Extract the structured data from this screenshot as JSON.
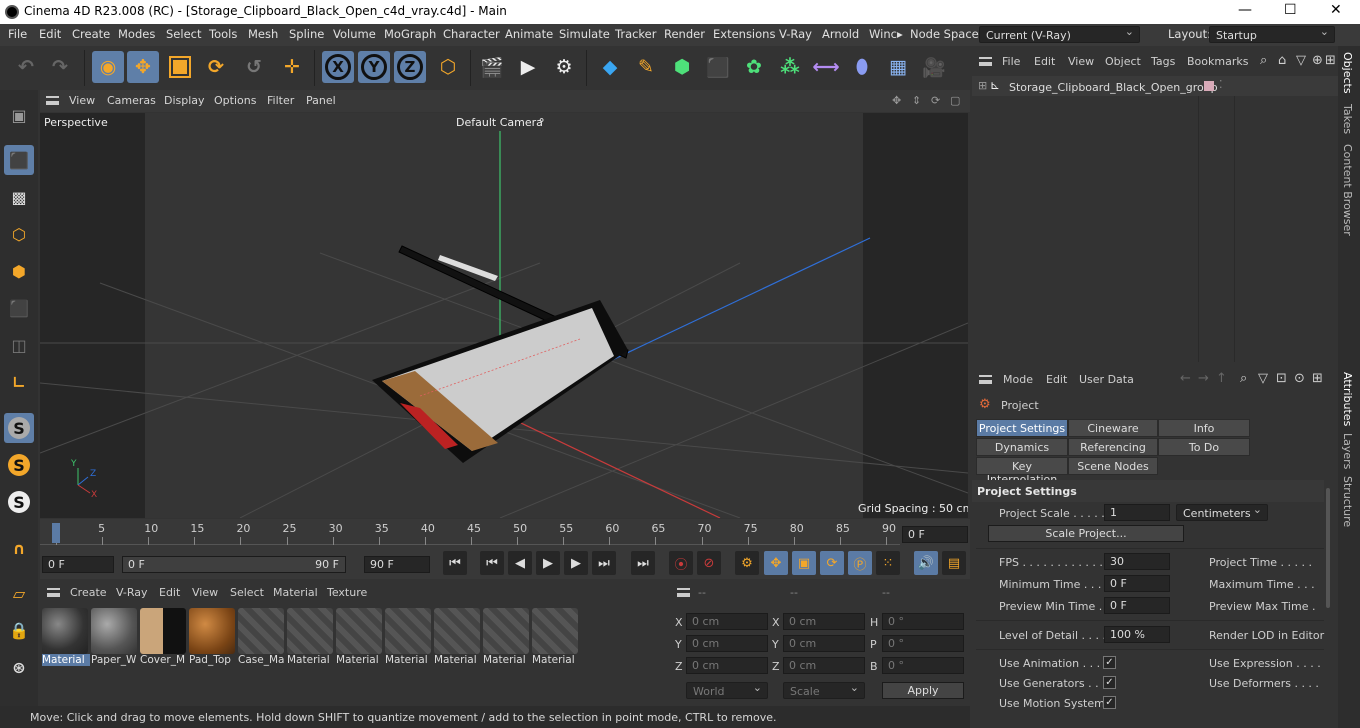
{
  "window": {
    "title": "Cinema 4D R23.008 (RC) - [Storage_Clipboard_Black_Open_c4d_vray.c4d] - Main",
    "min": "—",
    "max": "☐",
    "close": "✕"
  },
  "menubar": {
    "items": [
      "File",
      "Edit",
      "Create",
      "Modes",
      "Select",
      "Tools",
      "Mesh",
      "Spline",
      "Volume",
      "MoGraph",
      "Character",
      "Animate",
      "Simulate",
      "Tracker",
      "Render",
      "Extensions",
      "V-Ray",
      "Arnold",
      "Winc"
    ],
    "more": "▸",
    "nodespace_label": "Node Space:",
    "nodespace_value": "Current (V-Ray)",
    "layout_label": "Layout:",
    "layout_value": "Startup"
  },
  "viewport": {
    "menu": [
      "View",
      "Cameras",
      "Display",
      "Options",
      "Filter",
      "Panel"
    ],
    "label_perspective": "Perspective",
    "label_camera": "Default Camera",
    "camera_glyph": "⚬",
    "grid_spacing": "Grid Spacing : 50 cm",
    "axis": {
      "y": "Y",
      "z": "Z",
      "x": "X"
    }
  },
  "timeline": {
    "ticks": [
      "0",
      "5",
      "10",
      "15",
      "20",
      "25",
      "30",
      "35",
      "40",
      "45",
      "50",
      "55",
      "60",
      "65",
      "70",
      "75",
      "80",
      "85",
      "90"
    ],
    "current_frame": "0 F",
    "start_frame": "0 F",
    "range_start": "0 F",
    "range_end": "90 F",
    "end_frame": "90 F"
  },
  "materials": {
    "menu": [
      "Create",
      "V-Ray",
      "Edit",
      "View",
      "Select",
      "Material",
      "Texture"
    ],
    "items": [
      "Material",
      "Paper_W",
      "Cover_M",
      "Pad_Top",
      "Case_Ma",
      "Material",
      "Material",
      "Material",
      "Material",
      "Material",
      "Material"
    ]
  },
  "coords": {
    "header": [
      "--",
      "--",
      "--"
    ],
    "rows": [
      {
        "a": "X",
        "av": "0 cm",
        "b": "X",
        "bv": "0 cm",
        "c": "H",
        "cv": "0 °"
      },
      {
        "a": "Y",
        "av": "0 cm",
        "b": "Y",
        "bv": "0 cm",
        "c": "P",
        "cv": "0 °"
      },
      {
        "a": "Z",
        "av": "0 cm",
        "b": "Z",
        "bv": "0 cm",
        "c": "B",
        "cv": "0 °"
      }
    ],
    "world": "World",
    "scale": "Scale",
    "apply": "Apply"
  },
  "objects": {
    "menu": [
      "File",
      "Edit",
      "View",
      "Object",
      "Tags",
      "Bookmarks"
    ],
    "tree": [
      {
        "name": "Storage_Clipboard_Black_Open_group"
      }
    ]
  },
  "attributes": {
    "menu": [
      "Mode",
      "Edit",
      "User Data"
    ],
    "title": "Project",
    "tabs_row1": [
      "Project Settings",
      "Cineware",
      "Info"
    ],
    "tabs_row2": [
      "Dynamics",
      "Referencing",
      "To Do"
    ],
    "tabs_row3": [
      "Key Interpolation",
      "Scene Nodes"
    ],
    "section": "Project Settings",
    "project_scale_label": "Project Scale . . . . .",
    "project_scale_value": "1",
    "project_scale_unit": "Centimeters",
    "scale_project_button": "Scale Project...",
    "fields_left": [
      {
        "label": "FPS . . . . . . . . . . . . .",
        "value": "30"
      },
      {
        "label": "Minimum Time . . . .",
        "value": "0 F"
      },
      {
        "label": "Preview Min Time . .",
        "value": "0 F"
      }
    ],
    "fields_right": [
      "Project Time . . . . .",
      "Maximum Time . . .",
      "Preview Max Time ."
    ],
    "lod_label": "Level of Detail . . . .",
    "lod_value": "100 %",
    "render_lod": "Render LOD in Editor",
    "checks_left": [
      "Use Animation . . . . .",
      "Use Generators . . . .",
      "Use Motion System"
    ],
    "checks_right": [
      "Use Expression . . . .",
      "Use Deformers . . . ."
    ],
    "check_glyph": "✓"
  },
  "right_tabs": {
    "top": [
      "Objects",
      "Takes",
      "Content Browser"
    ],
    "bottom": [
      "Attributes",
      "Layers",
      "Structure"
    ]
  },
  "status": "Move: Click and drag to move elements. Hold down SHIFT to quantize movement / add to the selection in point mode, CTRL to remove.",
  "colors": {
    "accent": "#5b7ba5",
    "axis_x": "#c83b3b",
    "axis_y": "#3ec46b",
    "axis_z": "#2f6fd8",
    "highlight": "#ffbf3a"
  },
  "toolbar_icons": [
    "undo-icon",
    "redo-icon",
    "live-selection-icon",
    "move-icon",
    "scale-icon",
    "rotate-icon",
    "recent-tools-icon",
    "world-axis-icon",
    "x-axis-icon",
    "y-axis-icon",
    "z-axis-icon",
    "coordinate-system-icon",
    "render-view-icon",
    "render-picture-viewer-icon",
    "render-settings-icon",
    "cube-icon",
    "pen-icon",
    "subdivision-icon",
    "extrude-icon",
    "cloner-icon",
    "mograph-icon",
    "deformer-icon",
    "field-icon",
    "floor-icon",
    "camera-icon",
    "light-icon"
  ]
}
